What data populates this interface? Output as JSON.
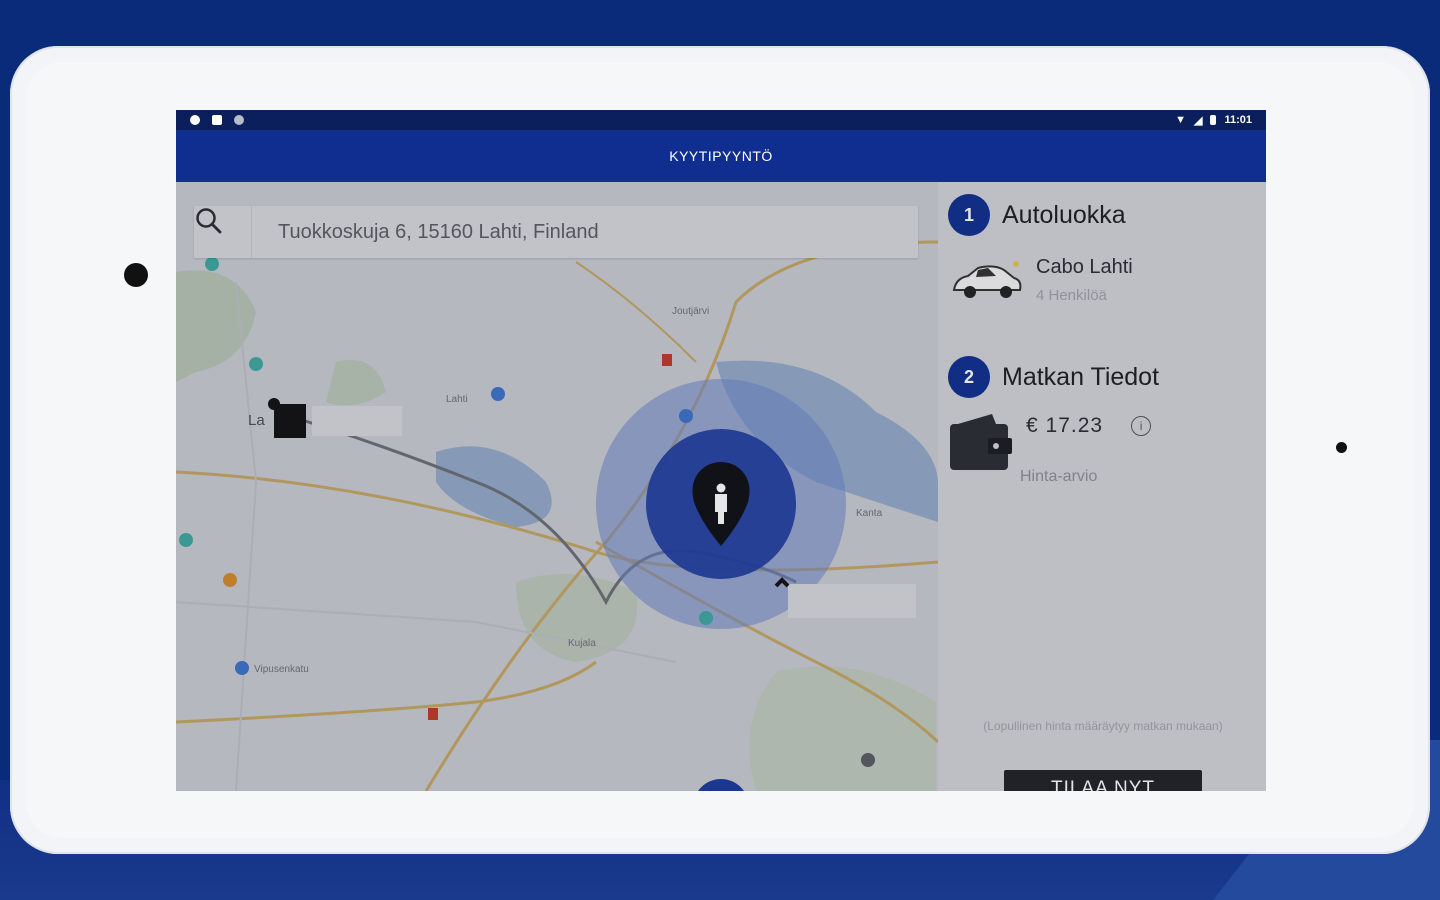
{
  "statusbar": {
    "time": "11:01"
  },
  "appbar": {
    "title": "KYYTIPYYNTÖ"
  },
  "search": {
    "value": "Tuokkoskuja 6, 15160 Lahti, Finland"
  },
  "map": {
    "labels": {
      "l1": "Joutjärvi",
      "l2": "Lahti",
      "l3": "Kanta",
      "l4": "Kujala",
      "l5": "Vipusenkatu",
      "l6": "La"
    }
  },
  "panel": {
    "step1": {
      "number": "1",
      "title": "Autoluokka"
    },
    "car": {
      "name": "Cabo Lahti",
      "capacity": "4 Henkilöä"
    },
    "step2": {
      "number": "2",
      "title": "Matkan Tiedot"
    },
    "price": {
      "value": "€ 17.23",
      "label": "Hinta-arvio"
    },
    "note": "(Lopullinen hinta määräytyy matkan mukaan)",
    "order_button": "TILAA NYT"
  },
  "colors": {
    "primary": "#0f2e8f",
    "background": "#0a2a7a",
    "button": "#1f2126"
  },
  "icons": {
    "search": "search-icon",
    "car": "car-icon",
    "wallet": "wallet-icon",
    "info": "info-icon",
    "pin": "person-pin-icon"
  }
}
